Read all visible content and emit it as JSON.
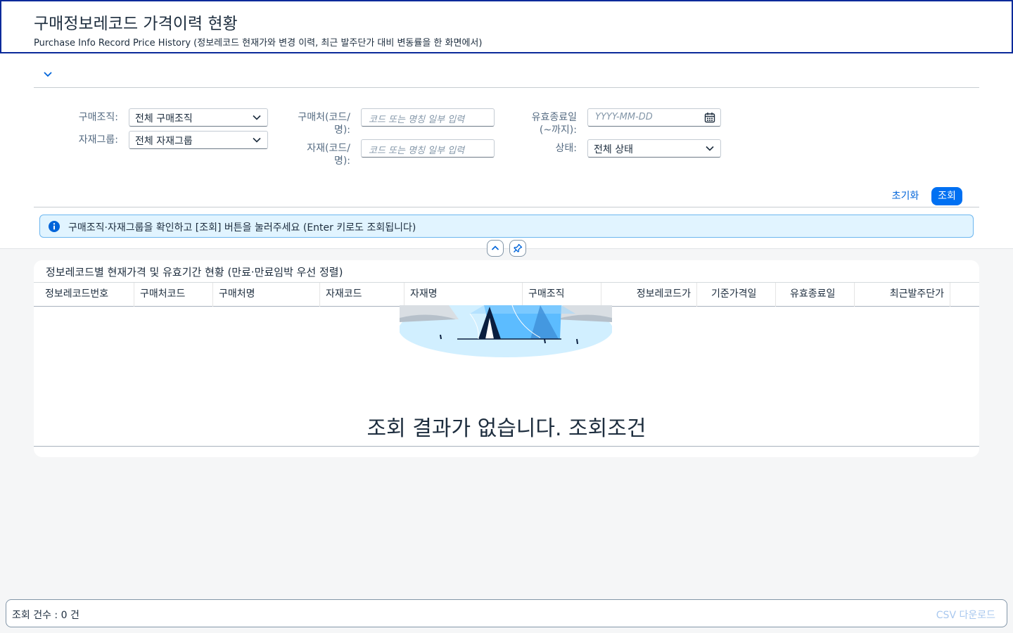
{
  "header": {
    "title": "구매정보레코드 가격이력 현황",
    "subtitle": "Purchase Info Record Price History (정보레코드 현재가와 변경 이력, 최근 발주단가 대비 변동률을 한 화면에서)"
  },
  "filters": {
    "purch_org": {
      "label": "구매조직:",
      "value": "전체 구매조직"
    },
    "material_group": {
      "label": "자재그룹:",
      "value": "전체 자재그룹"
    },
    "vendor": {
      "label_line1": "구매처(코드/",
      "label_line2": "명):",
      "placeholder": "코드 또는 명칭 일부 입력"
    },
    "material": {
      "label_line1": "자재(코드/",
      "label_line2": "명):",
      "placeholder": "코드 또는 명칭 일부 입력"
    },
    "valid_to": {
      "label_line1": "유효종료일",
      "label_line2": "(~까지):",
      "placeholder": "YYYY-MM-DD"
    },
    "status": {
      "label": "상태:",
      "value": "전체 상태"
    }
  },
  "actions": {
    "reset": "초기화",
    "search": "조회"
  },
  "info_message": "구매조직·자재그룹을 확인하고 [조회] 버튼을 눌러주세요 (Enter 키로도 조회됩니다)",
  "table": {
    "title": "정보레코드별 현재가격 및 유효기간 현황 (만료·만료임박 우선 정렬)",
    "columns": [
      "정보레코드번호",
      "구매처코드",
      "구매처명",
      "자재코드",
      "자재명",
      "구매조직",
      "정보레코드가",
      "기준가격일",
      "유효종료일",
      "최근발주단가"
    ],
    "empty_text": "조회 결과가 없습니다. 조회조건"
  },
  "footer": {
    "count": "조회 건수 : 0 건",
    "csv": "CSV 다운로드"
  },
  "colors": {
    "accent": "#0070f2",
    "header_border": "#0a2a9a",
    "info_bg": "#e1f4ff"
  },
  "icons": [
    "chevron-down-icon",
    "calendar-icon",
    "info-icon",
    "chevron-up-icon",
    "pin-icon"
  ]
}
